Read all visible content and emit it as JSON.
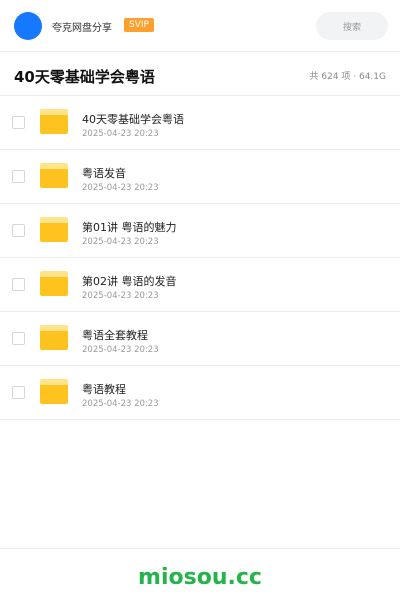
{
  "header": {
    "app_name": "夸克网盘分享",
    "badge": "SVIP",
    "search_placeholder": "搜索"
  },
  "title_bar": {
    "title": "40天零基础学会粤语",
    "summary": "共 624 项 · 64.1G"
  },
  "items": [
    {
      "name": "40天零基础学会粤语",
      "date": "2025-04-23 20:23"
    },
    {
      "name": "粤语发音",
      "date": "2025-04-23 20:23"
    },
    {
      "name": "第01讲 粤语的魅力",
      "date": "2025-04-23 20:23"
    },
    {
      "name": "第02讲 粤语的发音",
      "date": "2025-04-23 20:23"
    },
    {
      "name": "粤语全套教程",
      "date": "2025-04-23 20:23"
    },
    {
      "name": "粤语教程",
      "date": "2025-04-23 20:23"
    }
  ],
  "footer": {
    "brand": "miosou.cc"
  },
  "colors": {
    "accent_blue": "#1677ff",
    "badge_orange": "#ff9f2e",
    "folder_yellow": "#ffc31f",
    "brand_green": "#25b34b"
  },
  "icons": {
    "avatar": "avatar-circle",
    "folder": "folder-icon",
    "checkbox": "checkbox-icon"
  }
}
